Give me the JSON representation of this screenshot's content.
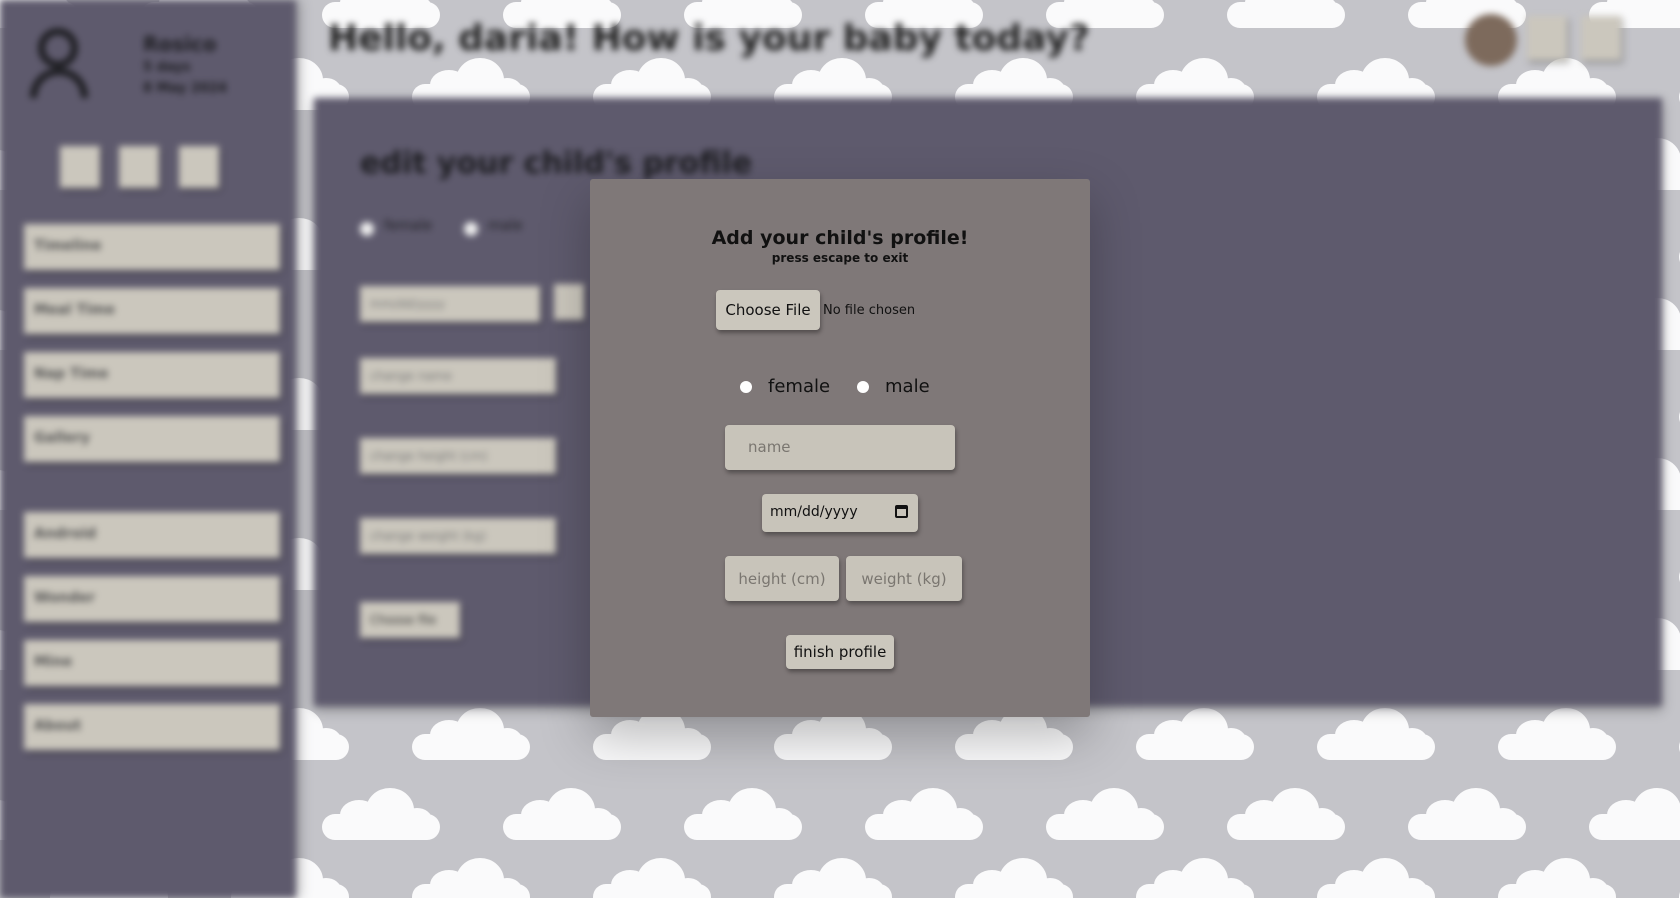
{
  "background": {
    "greeting": "Hello, daria! How is your baby today?",
    "sidebar": {
      "user_name": "Rosico",
      "user_age": "5 days",
      "user_dob": "8 May 2024",
      "items": [
        "Timeline",
        "Meal Time",
        "Nap Time",
        "Gallery",
        "Android",
        "Wonder",
        "Mine",
        "About"
      ]
    },
    "panel": {
      "title": "edit your child's profile",
      "radio_female": "female",
      "radio_male": "male",
      "date_placeholder": "mm/dd/yyyy",
      "name_placeholder": "change name",
      "height_placeholder": "change height (cm)",
      "weight_placeholder": "change weight (kg)",
      "file_button": "Choose file"
    }
  },
  "modal": {
    "title": "Add your child's profile!",
    "subtitle": "press escape to exit",
    "choose_file_label": "Choose File",
    "no_file_text": "No file chosen",
    "gender_options": [
      "female",
      "male"
    ],
    "name_placeholder": "name",
    "date_placeholder": "mm/dd/yyyy",
    "height_placeholder": "height (cm)",
    "weight_placeholder": "weight (kg)",
    "submit_label": "finish profile"
  },
  "colors": {
    "sidebar": "#5e5a6d",
    "modal": "#7f7878",
    "button": "#cbc7bd",
    "background": "#c4c4c9"
  }
}
